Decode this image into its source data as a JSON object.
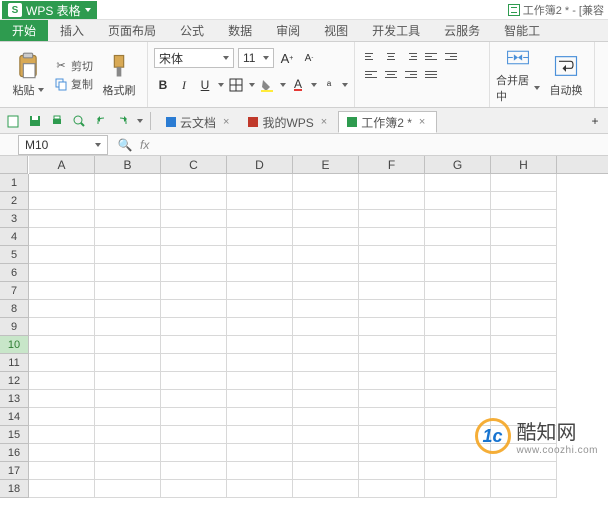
{
  "app": {
    "name": "WPS 表格",
    "title_suffix": "工作簿2 * - [兼容"
  },
  "tabs": [
    "开始",
    "插入",
    "页面布局",
    "公式",
    "数据",
    "审阅",
    "视图",
    "开发工具",
    "云服务",
    "智能工"
  ],
  "active_tab": 0,
  "clipboard": {
    "paste": "粘贴",
    "cut": "剪切",
    "copy": "复制",
    "fmt": "格式刷"
  },
  "font": {
    "name": "宋体",
    "size": "11",
    "bold": "B",
    "italic": "I",
    "underline": "U"
  },
  "align": {
    "merge": "合并居中",
    "wrap": "自动换"
  },
  "font_grow": "A",
  "font_shrink": "A",
  "doctabs": [
    {
      "label": "云文档",
      "color": "#2b7cd3",
      "active": false
    },
    {
      "label": "我的WPS",
      "color": "#c0392b",
      "active": false
    },
    {
      "label": "工作簿2 *",
      "color": "#2e9b4f",
      "active": true
    }
  ],
  "namebox": "M10",
  "fx_label": "fx",
  "columns": [
    "A",
    "B",
    "C",
    "D",
    "E",
    "F",
    "G",
    "H"
  ],
  "rows": [
    1,
    2,
    3,
    4,
    5,
    6,
    7,
    8,
    9,
    10,
    11,
    12,
    13,
    14,
    15,
    16,
    17,
    18
  ],
  "selected_row": 10,
  "watermark": {
    "logo": "1c",
    "cn": "酷知网",
    "url": "www.coozhi.com"
  }
}
